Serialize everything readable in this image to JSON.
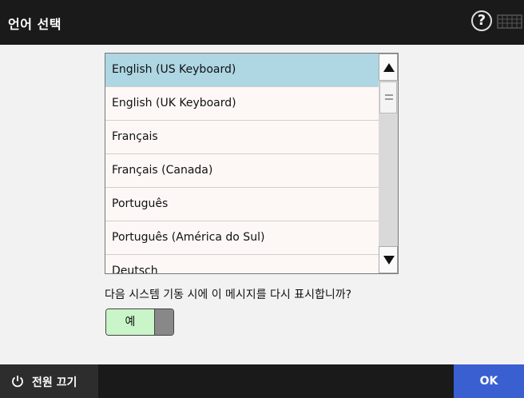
{
  "window": {
    "title": "언어 선택"
  },
  "header": {
    "help_glyph": "?",
    "help_icon": "question-circle-icon",
    "keyboard_icon": "keyboard-icon"
  },
  "languages": {
    "selected_index": 0,
    "items": [
      "English (US Keyboard)",
      "English (UK Keyboard)",
      "Français",
      "Français (Canada)",
      "Português",
      "Português (América do Sul)",
      "Deutsch"
    ]
  },
  "scrollbar": {
    "up_icon": "triangle-up-icon",
    "down_icon": "triangle-down-icon"
  },
  "startup_prompt": {
    "text": "다음 시스템 기동 시에 이 메시지를 다시 표시합니까?",
    "toggle_value": "예",
    "toggle_on": true
  },
  "footer": {
    "power_label": "전원 끄기",
    "power_icon": "power-icon",
    "ok_label": "OK"
  },
  "colors": {
    "header_bg": "#1a1a1a",
    "selected_row": "#aed6e3",
    "row_bg": "#fdf8f6",
    "toggle_on": "#c9f5c9",
    "ok_button": "#3a5fd0",
    "power_button": "#2d2d2d"
  }
}
